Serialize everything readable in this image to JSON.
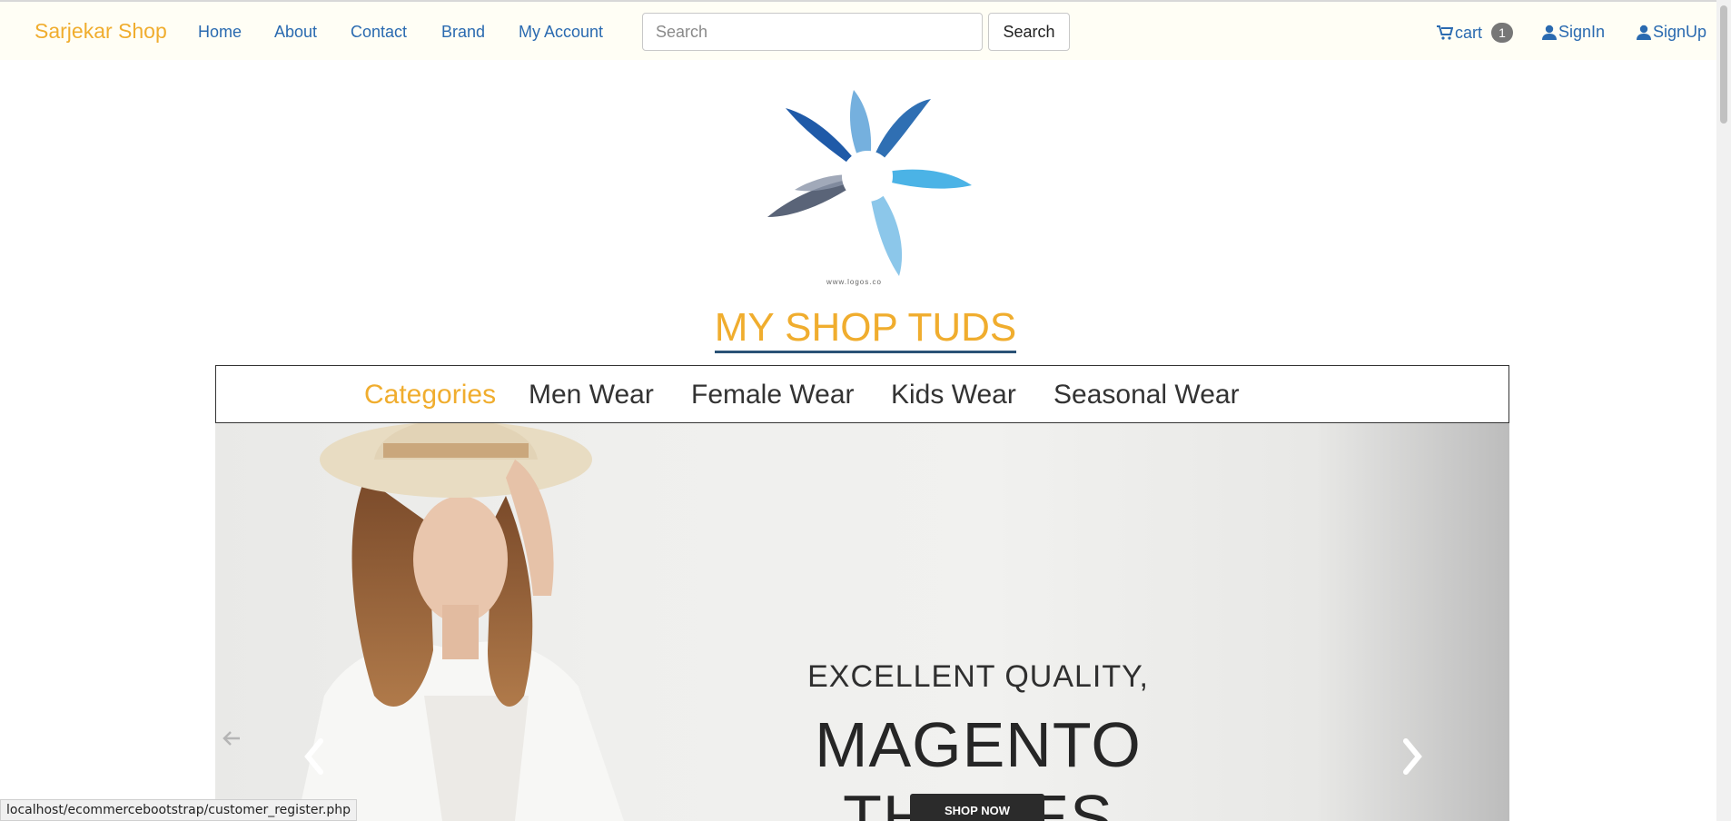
{
  "nav": {
    "brand": "Sarjekar Shop",
    "links": [
      "Home",
      "About",
      "Contact",
      "Brand",
      "My Account"
    ],
    "search_placeholder": "Search",
    "search_button": "Search",
    "cart_label": "cart",
    "cart_count": "1",
    "signin": "SignIn",
    "signup": "SignUp"
  },
  "logo_caption": "www.logos.co",
  "site_title": "MY SHOP TUDS",
  "categories": {
    "heading": "Categories",
    "items": [
      "Men Wear",
      "Female Wear",
      "Kids Wear",
      "Seasonal Wear"
    ]
  },
  "hero": {
    "line1": "EXCELLENT QUALITY,",
    "line2": "MAGENTO THEMES",
    "button": "SHOP NOW"
  },
  "status_url": "localhost/ecommercebootstrap/customer_register.php",
  "colors": {
    "accent": "#f0ad2e",
    "link": "#2a6ab0",
    "navbar_bg": "#fffef5"
  }
}
